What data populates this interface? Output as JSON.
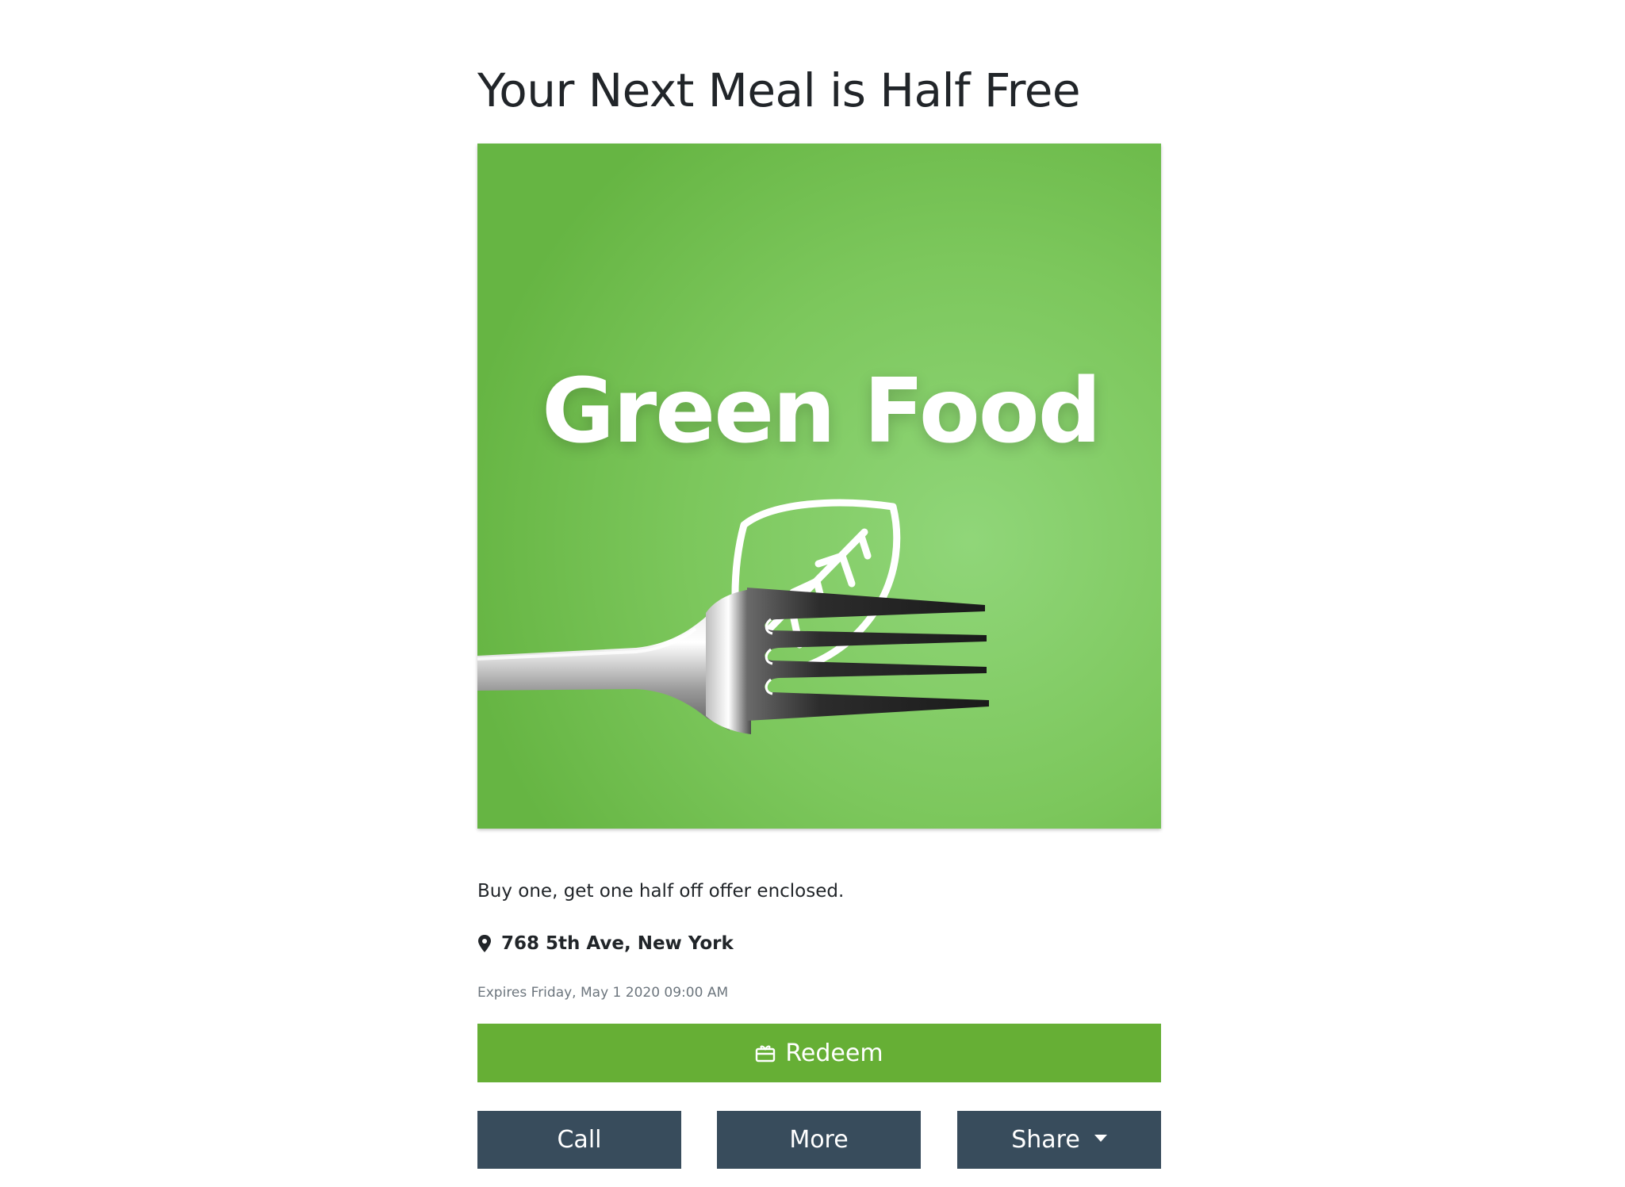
{
  "offer": {
    "title": "Your Next Meal is Half Free",
    "hero_image": {
      "logo_text": "Green Food",
      "icon": "leaf-icon",
      "background_color": "#72c04f"
    },
    "description": "Buy one, get one half off offer enclosed.",
    "address": "768 5th Ave, New York",
    "expires": "Expires Friday, May 1 2020 09:00 AM"
  },
  "actions": {
    "redeem_label": "Redeem",
    "call_label": "Call",
    "more_label": "More",
    "share_label": "Share"
  },
  "colors": {
    "redeem": "#66af35",
    "secondary": "#384c5c",
    "text": "#212529",
    "muted": "#6c757d"
  }
}
